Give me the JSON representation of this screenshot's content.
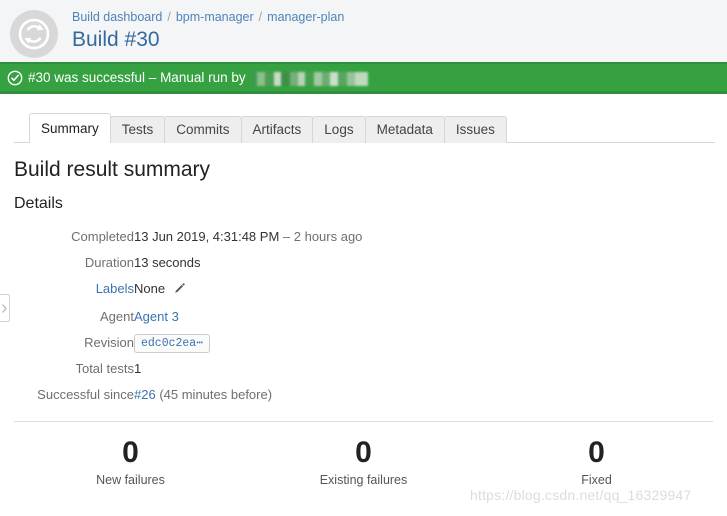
{
  "header": {
    "avatar_icon": "build-refresh-icon",
    "breadcrumb": [
      {
        "label": "Build dashboard"
      },
      {
        "label": "bpm-manager"
      },
      {
        "label": "manager-plan"
      }
    ],
    "separator": "/",
    "title": "Build #30"
  },
  "banner": {
    "icon": "check-circle-icon",
    "text": "#30 was successful – Manual run by",
    "user_redacted": "",
    "background_color": "#36a141"
  },
  "tabs": [
    {
      "label": "Summary",
      "active": true
    },
    {
      "label": "Tests",
      "active": false
    },
    {
      "label": "Commits",
      "active": false
    },
    {
      "label": "Artifacts",
      "active": false
    },
    {
      "label": "Logs",
      "active": false
    },
    {
      "label": "Metadata",
      "active": false
    },
    {
      "label": "Issues",
      "active": false
    }
  ],
  "main": {
    "section_title": "Build result summary",
    "sub_title": "Details",
    "details": [
      {
        "label": "Completed",
        "label_link": false,
        "value": "13 Jun 2019, 4:31:48 PM",
        "suffix": "– 2 hours ago"
      },
      {
        "label": "Duration",
        "label_link": false,
        "value": "13 seconds"
      },
      {
        "label": "Labels",
        "label_link": true,
        "value": "None",
        "edit_icon": "pencil-icon"
      },
      {
        "label": "Agent",
        "label_link": false,
        "value": "Agent 3"
      },
      {
        "label": "Revision",
        "label_link": false,
        "value": "edc0c2ea⋯"
      },
      {
        "label": "Total tests",
        "label_link": false,
        "value": "1"
      },
      {
        "label": "Successful since",
        "label_link": false,
        "value": "#26",
        "suffix": "(45 minutes before)"
      }
    ],
    "stats": [
      {
        "number": "0",
        "label": "New failures"
      },
      {
        "number": "0",
        "label": "Existing failures"
      },
      {
        "number": "0",
        "label": "Fixed"
      }
    ]
  },
  "watermark": {
    "text": "https://blog.csdn.net/qq_16329947"
  },
  "colors": {
    "success_green": "#36a141",
    "link_blue": "#3b73af",
    "header_bg": "#f4f5f7"
  }
}
